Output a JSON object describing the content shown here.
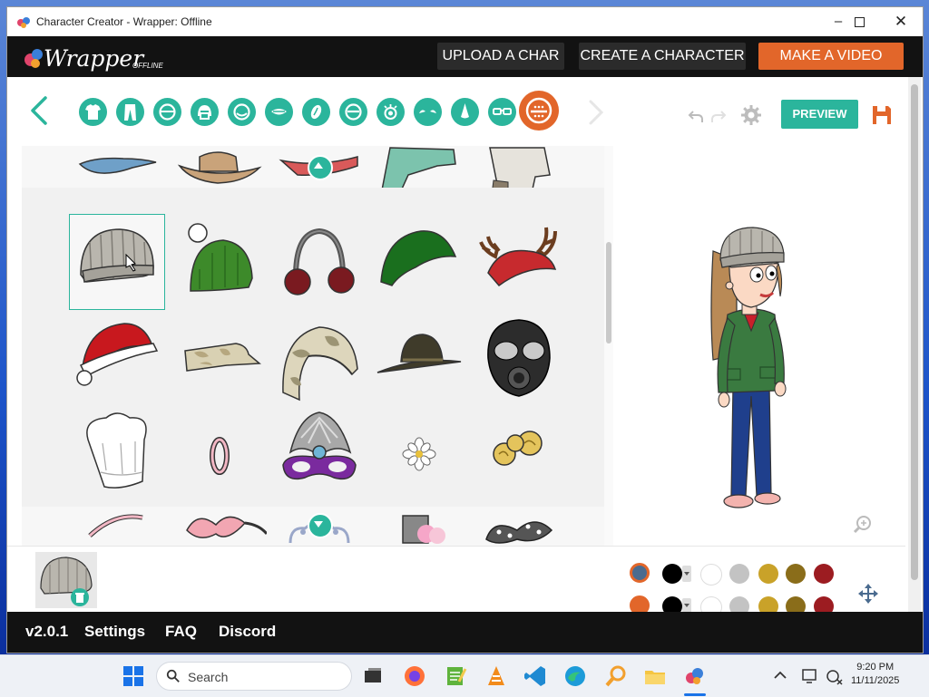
{
  "window": {
    "title": "Character Creator - Wrapper: Offline"
  },
  "brand": {
    "logo": "Wrapper",
    "logo_sub": "OFFLINE"
  },
  "topnav": [
    {
      "label": "UPLOAD A CHAR"
    },
    {
      "label": "CREATE A CHARACTER"
    },
    {
      "label": "MAKE A VIDEO"
    }
  ],
  "toolbar": {
    "categories": [
      "shirt-icon",
      "pants-icon",
      "face-shape-icon",
      "hair-icon",
      "head-shape-icon",
      "mouth-icon",
      "eyebrow-icon",
      "ear-icon",
      "eye-icon",
      "eyelash-icon",
      "nose-icon",
      "glasses-icon",
      "hat-accessory-icon"
    ],
    "active_category": "hat-accessory-icon",
    "preview_label": "PREVIEW"
  },
  "hats": [
    {
      "row": 0,
      "items": [
        "blue-cap",
        "brown-cowboy-hat",
        "red-bandana",
        "teal-trapper-cap",
        "grey-aviator-hat"
      ]
    },
    {
      "row": 1,
      "items": [
        "grey-knit-beanie",
        "green-bobble-beanie",
        "maroon-earmuffs",
        "green-elf-hat",
        "red-antler-hat"
      ]
    },
    {
      "row": 2,
      "items": [
        "santa-hat",
        "camo-cap",
        "camo-helmet",
        "campaign-hat",
        "gas-mask"
      ]
    },
    {
      "row": 3,
      "items": [
        "chef-hat",
        "hair-tie",
        "mardi-gras-mask",
        "white-flower",
        "gold-hair-buns"
      ]
    },
    {
      "row": 4,
      "items": [
        "pink-headband",
        "pink-bow",
        "tiara",
        "top-hat-fascinator",
        "polka-dot-bow"
      ]
    }
  ],
  "selected_hat": "grey-knit-beanie",
  "colors": {
    "row1": [
      "#4a6b8f",
      "#000000",
      "#ffffff",
      "#c3c3c3",
      "#c9a229",
      "#8a6d1a",
      "#9c1c21"
    ],
    "row2": [
      "#e2662a",
      "#000000",
      "#ffffff",
      "#c3c3c3",
      "#c9a229",
      "#8a6d1a",
      "#9c1c21"
    ],
    "accent": "#2bb59c",
    "orange": "#e2662a"
  },
  "footer": {
    "version": "v2.0.1",
    "settings": "Settings",
    "faq": "FAQ",
    "discord": "Discord"
  },
  "taskbar": {
    "search_placeholder": "Search",
    "time": "9:20 PM",
    "date": "11/11/2025"
  }
}
